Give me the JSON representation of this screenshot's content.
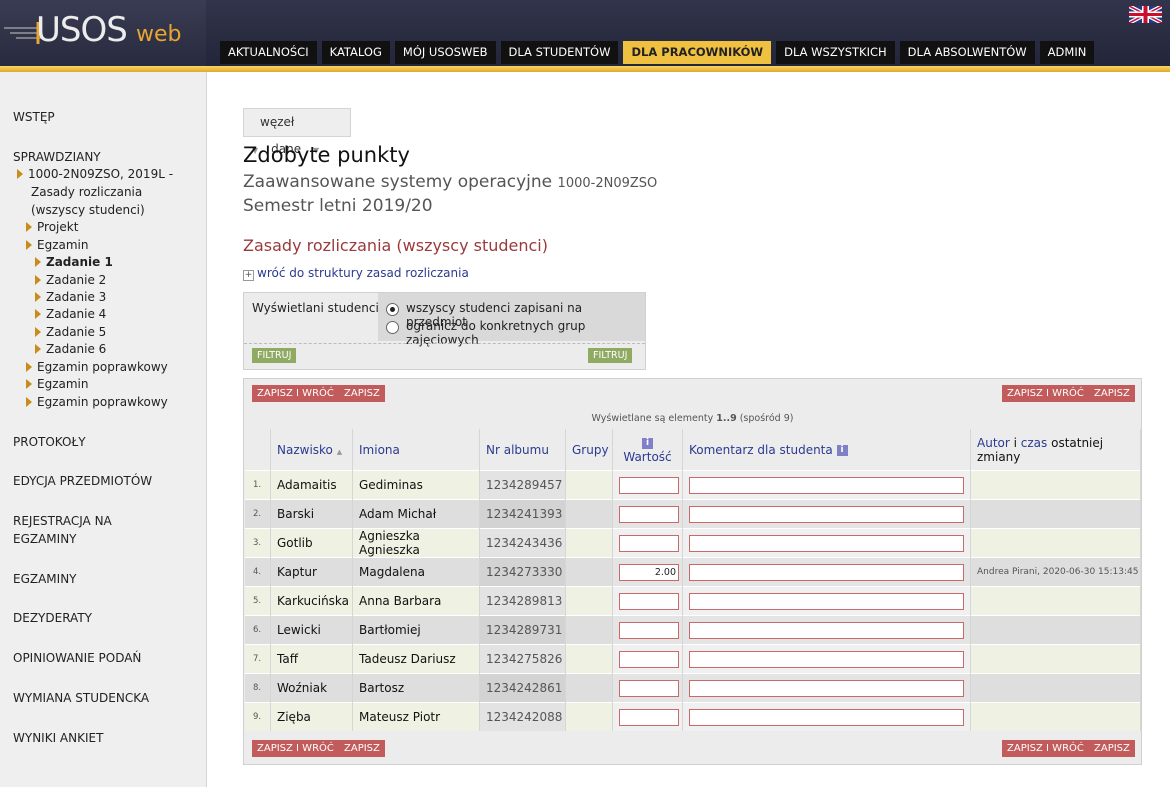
{
  "header": {
    "logo": "USOS",
    "logo_suffix": "web",
    "nav": [
      "AKTUALNOŚCI",
      "KATALOG",
      "MÓJ USOSWEB",
      "DLA STUDENTÓW",
      "DLA PRACOWNIKÓW",
      "DLA WSZYSTKICH",
      "DLA ABSOLWENTÓW",
      "ADMIN"
    ],
    "active_nav": "DLA PRACOWNIKÓW"
  },
  "sidebar": {
    "wstep": "WSTĘP",
    "sprawdziany": "SPRAWDZIANY",
    "course_line1": "1000-2N09ZSO, 2019L -",
    "course_line2": "Zasady rozliczania",
    "course_line3": "(wszyscy studenci)",
    "projekt": "Projekt",
    "egzamin": "Egzamin",
    "zad1": "Zadanie 1",
    "zad2": "Zadanie 2",
    "zad3": "Zadanie 3",
    "zad4": "Zadanie 4",
    "zad5": "Zadanie 5",
    "zad6": "Zadanie 6",
    "egz_popr1": "Egzamin poprawkowy",
    "egzamin2": "Egzamin",
    "egz_popr2": "Egzamin poprawkowy",
    "protokoly": "PROTOKOŁY",
    "edycja": "EDYCJA PRZEDMIOTÓW",
    "rejestracja1": "REJESTRACJA NA",
    "rejestracja2": "EGZAMINY",
    "egzaminy": "EGZAMINY",
    "dezyderaty": "DEZYDERATY",
    "opiniowanie": "OPINIOWANIE PODAŃ",
    "wymiana": "WYMIANA STUDENCKA",
    "wyniki": "WYNIKI ANKIET"
  },
  "crumb": {
    "a": "węzeł",
    "b": "dane"
  },
  "title": "Zdobyte punkty",
  "course_name": "Zaawansowane systemy operacyjne",
  "course_code": "1000-2N09ZSO",
  "semester": "Semestr letni 2019/20",
  "section": "Zasady rozliczania (wszyscy studenci)",
  "back_link": "wróć do struktury zasad rozliczania",
  "filter": {
    "label": "Wyświetlani studenci:",
    "opt1": "wszyscy studenci zapisani na przedmiot",
    "opt2": "ogranicz do konkretnych grup zajęciowych",
    "btn": "FILTRUJ"
  },
  "buttons": {
    "save_back": "ZAPISZ I WRÓĆ",
    "save": "ZAPISZ"
  },
  "shown": {
    "prefix": "Wyświetlane są elementy ",
    "range": "1..9",
    "suffix": " (spośród 9)"
  },
  "columns": {
    "nazwisko": "Nazwisko",
    "imiona": "Imiona",
    "album": "Nr albumu",
    "grupy": "Grupy",
    "wartosc": "Wartość",
    "komentarz": "Komentarz dla studenta",
    "autor": "Autor",
    "i": " i ",
    "czas": "czas",
    "zmiany": " ostatniej zmiany"
  },
  "rows": [
    {
      "n": "1.",
      "nazwisko": "Adamaitis",
      "imiona": "Gediminas",
      "album": "1234289457",
      "value": "",
      "audit": ""
    },
    {
      "n": "2.",
      "nazwisko": "Barski",
      "imiona": "Adam Michał",
      "album": "1234241393",
      "value": "",
      "audit": ""
    },
    {
      "n": "3.",
      "nazwisko": "Gotlib",
      "imiona": "Agnieszka Agnieszka",
      "album": "1234243436",
      "value": "",
      "audit": ""
    },
    {
      "n": "4.",
      "nazwisko": "Kaptur",
      "imiona": "Magdalena",
      "album": "1234273330",
      "value": "2.00",
      "audit": "Andrea Pirani, 2020-06-30 15:13:45"
    },
    {
      "n": "5.",
      "nazwisko": "Karkucińska",
      "imiona": "Anna Barbara",
      "album": "1234289813",
      "value": "",
      "audit": ""
    },
    {
      "n": "6.",
      "nazwisko": "Lewicki",
      "imiona": "Bartłomiej",
      "album": "1234289731",
      "value": "",
      "audit": ""
    },
    {
      "n": "7.",
      "nazwisko": "Taff",
      "imiona": "Tadeusz Dariusz",
      "album": "1234275826",
      "value": "",
      "audit": ""
    },
    {
      "n": "8.",
      "nazwisko": "Woźniak",
      "imiona": "Bartosz",
      "album": "1234242861",
      "value": "",
      "audit": ""
    },
    {
      "n": "9.",
      "nazwisko": "Zięba",
      "imiona": "Mateusz Piotr",
      "album": "1234242088",
      "value": "",
      "audit": ""
    }
  ]
}
